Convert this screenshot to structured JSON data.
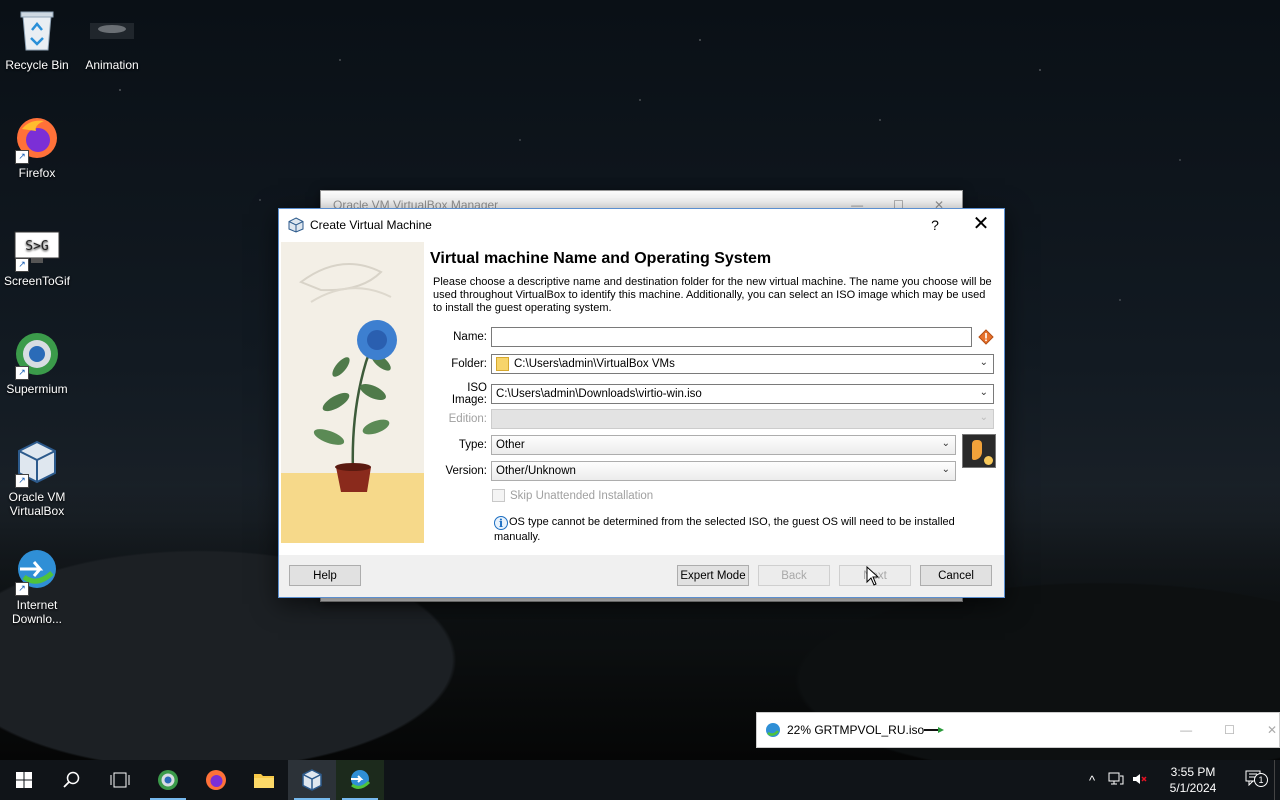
{
  "desktop": {
    "icons": [
      {
        "label": "Recycle Bin"
      },
      {
        "label": "Animation"
      },
      {
        "label": "Firefox"
      },
      {
        "label": "ScreenToGif"
      },
      {
        "label": "Supermium"
      },
      {
        "label": "Oracle VM VirtualBox"
      },
      {
        "label": "Internet Downlo..."
      }
    ]
  },
  "background_window": {
    "title": "Oracle VM VirtualBox Manager"
  },
  "dialog": {
    "title": "Create Virtual Machine",
    "help_glyph": "?",
    "close_glyph": "✕",
    "heading": "Virtual machine Name and Operating System",
    "description": "Please choose a descriptive name and destination folder for the new virtual machine. The name you choose will be used throughout VirtualBox to identify this machine. Additionally, you can select an ISO image which may be used to install the guest operating system.",
    "fields": {
      "name_label": "Name:",
      "name_value": "",
      "folder_label": "Folder:",
      "folder_value": "C:\\Users\\admin\\VirtualBox VMs",
      "iso_label": "ISO Image:",
      "iso_value": "C:\\Users\\admin\\Downloads\\virtio-win.iso",
      "edition_label": "Edition:",
      "edition_value": "",
      "type_label": "Type:",
      "type_value": "Other",
      "version_label": "Version:",
      "version_value": "Other/Unknown"
    },
    "skip_unattended_label": "Skip Unattended Installation",
    "info_message": "OS type cannot be determined from the selected ISO, the guest OS will need to be installed manually.",
    "buttons": {
      "help": "Help",
      "expert_mode": "Expert Mode",
      "back": "Back",
      "next": "Next",
      "cancel": "Cancel"
    }
  },
  "download": {
    "title": "22% GRTMPVOL_RU.iso",
    "minimize": "—",
    "maximize": "☐",
    "close": "✕"
  },
  "taskbar": {
    "apps": [
      "start",
      "search",
      "task-view",
      "supermium",
      "firefox",
      "file-explorer",
      "virtualbox",
      "internet-download-manager"
    ],
    "tray": {
      "time": "3:55 PM",
      "date": "5/1/2024",
      "notification_count": "1"
    }
  },
  "colors": {
    "accent": "#5b8fd0",
    "taskbar_bg": "#101418",
    "floor": "#f6d98a"
  }
}
